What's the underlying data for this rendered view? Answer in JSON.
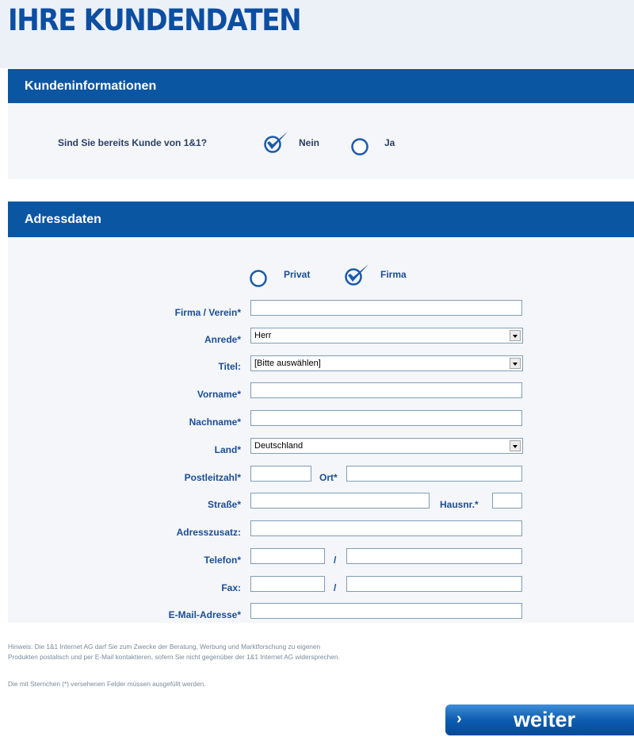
{
  "title": "IHRE KUNDENDATEN",
  "kundeninfo": {
    "header": "Kundeninformationen",
    "question": "Sind Sie bereits Kunde von 1&1?",
    "option_nein": "Nein",
    "option_ja": "Ja",
    "selected": "Nein"
  },
  "adress": {
    "header": "Adressdaten",
    "option_privat": "Privat",
    "option_firma": "Firma",
    "selected": "Firma",
    "labels": {
      "firma": "Firma / Verein*",
      "anrede": "Anrede*",
      "titel": "Titel:",
      "vorname": "Vorname*",
      "nachname": "Nachname*",
      "land": "Land*",
      "plz": "Postleitzahl*",
      "ort": "Ort*",
      "strasse": "Straße*",
      "hausnr": "Hausnr.*",
      "adresszusatz": "Adresszusatz:",
      "telefon": "Telefon*",
      "fax": "Fax:",
      "email": "E-Mail-Adresse*"
    },
    "values": {
      "firma": "",
      "anrede": "Herr",
      "titel": "[Bitte auswählen]",
      "vorname": "",
      "nachname": "",
      "land": "Deutschland",
      "plz": "",
      "ort": "",
      "strasse": "",
      "hausnr": "",
      "adresszusatz": "",
      "telefon_vorwahl": "",
      "telefon_nummer": "",
      "fax_vorwahl": "",
      "fax_nummer": "",
      "email": ""
    },
    "separator": "/"
  },
  "notes": {
    "hinweis_line1": "Hinweis: Die 1&1 Internet AG darf Sie zum Zwecke der Beratung, Werbung und Marktforschung zu eigenen",
    "hinweis_line2": "Produkten postalisch und per E-Mail kontaktieren, sofern Sie nicht gegenüber der 1&1 Internet AG widersprechen.",
    "pflicht": "Die mit Sternchen (*) versehenen Felder müssen ausgefüllt werden."
  },
  "button": {
    "arrow": "›",
    "label": "weiter"
  },
  "colors": {
    "brand_blue": "#0c4ea2",
    "header_blue": "#0b56a3",
    "label_blue": "#1b4d94",
    "panel_bg": "#f4f6f9"
  }
}
